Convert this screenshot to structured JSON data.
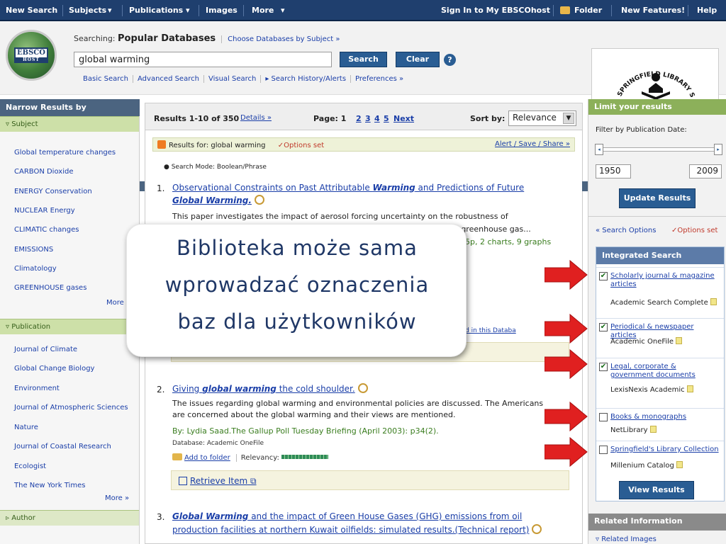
{
  "topnav": {
    "new_search": "New Search",
    "subjects": "Subjects",
    "publications": "Publications",
    "images": "Images",
    "more": "More",
    "sign_in": "Sign In to My EBSCOhost",
    "folder": "Folder",
    "new_features": "New Features!",
    "help": "Help"
  },
  "header": {
    "logo_top": "EBSCO",
    "logo_bottom": "HOST",
    "searching_label": "Searching:",
    "db_name": "Popular Databases",
    "choose_db": "Choose Databases by Subject »",
    "query": "global warming",
    "search_btn": "Search",
    "clear_btn": "Clear",
    "help_glyph": "?",
    "links": [
      "Basic Search",
      "Advanced Search",
      "Visual Search",
      "▸ Search History/Alerts",
      "Preferences »"
    ],
    "library_logo_text": "SPRINGFIELD LIBRARY SYSTEM"
  },
  "left": {
    "title": "Narrow Results by",
    "subject_section": "Subject",
    "subjects": [
      "Global temperature changes",
      "CARBON Dioxide",
      "ENERGY Conservation",
      "NUCLEAR Energy",
      "CLIMATIC changes",
      "EMISSIONS",
      "Climatology",
      "GREENHOUSE gases"
    ],
    "more": "More",
    "more2": "More »",
    "publication_section": "Publication",
    "publications": [
      "Journal of Climate",
      "Global Change Biology",
      "Environment",
      "Journal of Atmospheric Sciences",
      "Nature",
      "Journal of Coastal Research",
      "Ecologist",
      "The New York Times"
    ],
    "author_section": "Author"
  },
  "results": {
    "range": "Results 1-10 of 350",
    "details": "Details »",
    "page_label": "Page: 1",
    "pages": [
      "2",
      "3",
      "4",
      "5"
    ],
    "next": "Next",
    "sort_label": "Sort by:",
    "sort_value": "Relevance",
    "results_for": "Results for: global warming",
    "options_set": "✓Options set",
    "alert": "Alert / Save / Share »",
    "search_mode": "Search Mode: Boolean/Phrase",
    "items": [
      {
        "num": "1.",
        "title_a": "Observational Constraints on Past Attributable ",
        "title_b": "Warming",
        "title_c": " and Predictions of Future",
        "title_d": "Global Warming.",
        "abstract_1": "This paper investigates the impact of aerosol forcing uncertainty on the robustness of",
        "abstract_2": "genic greenhouse gas...",
        "source_frag": "15p, 2 charts, 9 graphs",
        "db_frag": "ted in this Databa"
      },
      {
        "num": "2.",
        "title_a": "Giving ",
        "title_b": "global warming",
        "title_c": " the cold shoulder.",
        "abstract_1": "The issues regarding global warming and environmental policies are discussed. The Americans",
        "abstract_2": "are concerned about the global warming and their views are mentioned.",
        "byline": "By: Lydia Saad.The Gallup Poll Tuesday Briefing (April 2003): p34(2).",
        "database": "Database: Academic OneFile",
        "add_folder": "Add to folder",
        "relevancy": "Relevancy:",
        "retrieve": "Retrieve Item"
      },
      {
        "num": "3.",
        "title_b": "Global Warming",
        "title_c": " and the impact of Green House Gases (GHG) emissions from oil",
        "title_d": "production facilities at northern Kuwait oilfields: simulated results.(Technical report)"
      }
    ]
  },
  "right": {
    "limit_title": "Limit your results",
    "filter_label": "Filter by Publication Date:",
    "date_from": "1950",
    "date_to": "2009",
    "update_btn": "Update Results",
    "search_options": "« Search Options",
    "options_set": "✓Options set",
    "integrated_title": "Integrated Search",
    "integrated": [
      {
        "label": "Scholarly journal & magazine articles",
        "source": "Academic Search Complete",
        "checked": true
      },
      {
        "label": "Periodical & newspaper articles",
        "source": "Academic OneFile",
        "checked": true
      },
      {
        "label": "Legal, corporate & government documents",
        "source": "LexisNexis Academic",
        "checked": true
      },
      {
        "label": "Books & monographs",
        "source": "NetLibrary",
        "checked": false
      },
      {
        "label": "Springfield's Library Collection",
        "source": "Millenium Catalog",
        "checked": false
      }
    ],
    "view_results": "View Results",
    "related_title": "Related Information",
    "related_images": "Related Images"
  },
  "callout": {
    "line1": "Biblioteka może sama",
    "line2": "wprowadzać oznaczenia",
    "line3": "baz dla użytkowników"
  },
  "colors": {
    "nav": "#1f3f6e",
    "accent_green": "#8cb05a",
    "arrow_red": "#e02020",
    "link": "#1a3ea8"
  }
}
